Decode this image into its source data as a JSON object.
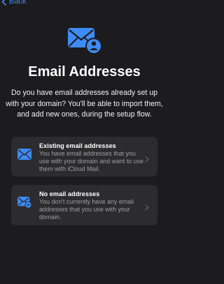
{
  "nav": {
    "back_label": "Back"
  },
  "title": "Email Addresses",
  "description": "Do you have email addresses already set up with your domain? You'll be able to import them, and add new ones, during the setup flow.",
  "options": [
    {
      "title": "Existing email addresses",
      "description": "You have email addresses that you use with your domain and want to use them with iCloud Mail.",
      "icon": "envelope-icon"
    },
    {
      "title": "No email addresses",
      "description": "You don't currently have any email addresses that you use with your domain.",
      "icon": "envelope-minus-icon"
    }
  ],
  "colors": {
    "accent": "#3d8bf7",
    "background": "#1c1c1e",
    "card": "#2c2c2e"
  }
}
